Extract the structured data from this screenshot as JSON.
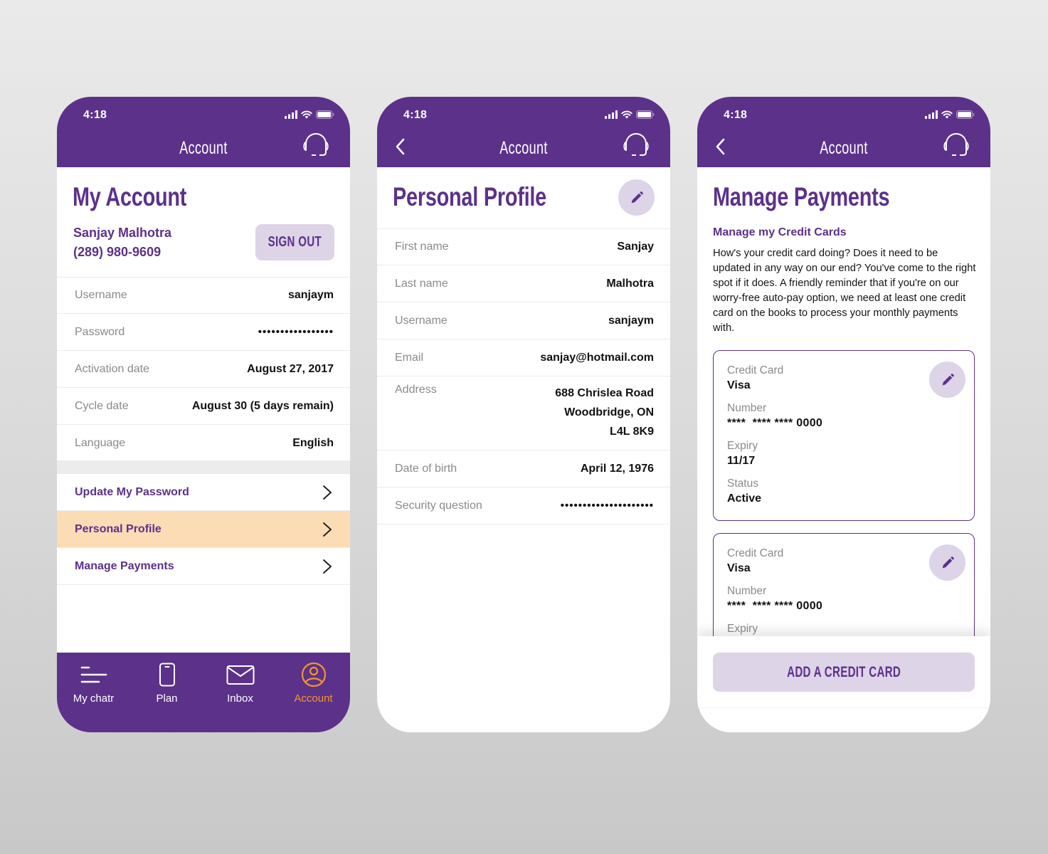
{
  "colors": {
    "brand_purple": "#5c318a",
    "lavender": "#ddd4e8",
    "highlight_peach": "#fcdcb4",
    "active_tab_orange": "#f1962e"
  },
  "status_bar": {
    "time": "4:18",
    "icons": [
      "signal-icon",
      "wifi-icon",
      "battery-icon"
    ]
  },
  "screens": {
    "my_account": {
      "nav_title": "Account",
      "heading": "My Account",
      "user_name": "Sanjay Malhotra",
      "user_phone": "(289) 980-9609",
      "sign_out_label": "SIGN OUT",
      "rows": [
        {
          "label": "Username",
          "value": "sanjaym"
        },
        {
          "label": "Password",
          "value": "•••••••••••••••••"
        },
        {
          "label": "Activation date",
          "value": "August 27, 2017"
        },
        {
          "label": "Cycle date",
          "value": "August 30 (5 days remain)"
        },
        {
          "label": "Language",
          "value": "English"
        }
      ],
      "links": [
        {
          "label": "Update My Password",
          "highlighted": false
        },
        {
          "label": "Personal Profile",
          "highlighted": true
        },
        {
          "label": "Manage Payments",
          "highlighted": false
        }
      ],
      "tabs": [
        {
          "label": "My chatr",
          "icon": "menu-lines-icon",
          "active": false
        },
        {
          "label": "Plan",
          "icon": "phone-device-icon",
          "active": false
        },
        {
          "label": "Inbox",
          "icon": "envelope-icon",
          "active": false
        },
        {
          "label": "Account",
          "icon": "user-circle-icon",
          "active": true
        }
      ]
    },
    "personal_profile": {
      "nav_title": "Account",
      "heading": "Personal Profile",
      "rows": [
        {
          "label": "First name",
          "value": "Sanjay"
        },
        {
          "label": "Last name",
          "value": "Malhotra"
        },
        {
          "label": "Username",
          "value": "sanjaym"
        },
        {
          "label": "Email",
          "value": "sanjay@hotmail.com"
        },
        {
          "label": "Address",
          "value_lines": [
            "688 Chrislea Road",
            "Woodbridge, ON",
            "L4L 8K9"
          ]
        },
        {
          "label": "Date of birth",
          "value": "April 12, 1976"
        },
        {
          "label": "Security question",
          "value": "•••••••••••••••••••••"
        }
      ]
    },
    "manage_payments": {
      "nav_title": "Account",
      "heading": "Manage Payments",
      "sub_heading": "Manage my Credit Cards",
      "intro": "How's your credit card doing? Does it need to be updated in any way on our end? You've come to the right spot if it does. A friendly reminder that if you're on our worry-free auto-pay option, we need at least one credit card on the books to process your monthly payments with.",
      "cards": [
        {
          "type_label": "Credit Card",
          "type_value": "Visa",
          "number_label": "Number",
          "number_value": "****  **** **** 0000",
          "expiry_label": "Expiry",
          "expiry_value": "11/17",
          "status_label": "Status",
          "status_value": "Active"
        },
        {
          "type_label": "Credit Card",
          "type_value": "Visa",
          "number_label": "Number",
          "number_value": "****  **** **** 0000",
          "expiry_label": "Expiry"
        }
      ],
      "add_card_label": "ADD A CREDIT CARD"
    }
  }
}
